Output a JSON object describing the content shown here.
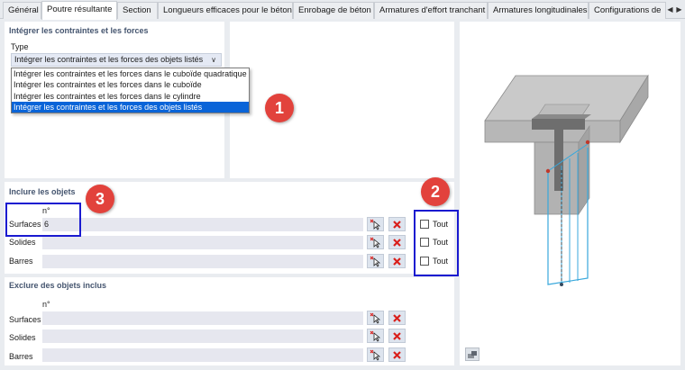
{
  "tabs": [
    {
      "label": "Général",
      "active": false
    },
    {
      "label": "Poutre résultante",
      "active": true
    },
    {
      "label": "Section",
      "active": false
    },
    {
      "label": "Longueurs efficaces pour le béton",
      "active": false
    },
    {
      "label": "Enrobage de béton",
      "active": false
    },
    {
      "label": "Armatures d'effort tranchant",
      "active": false
    },
    {
      "label": "Armatures longitudinales",
      "active": false
    },
    {
      "label": "Configurations de",
      "active": false
    }
  ],
  "integrate": {
    "title": "Intégrer les contraintes et les forces",
    "type_label": "Type",
    "selected": "Intégrer les contraintes et les forces des objets listés",
    "options": [
      "Intégrer les contraintes et les forces dans le cuboïde quadratique",
      "Intégrer les contraintes et les forces dans le cuboïde",
      "Intégrer les contraintes et les forces dans le cylindre",
      "Intégrer les contraintes et les forces des objets listés"
    ]
  },
  "include": {
    "title": "Inclure les objets",
    "col_header": "n°",
    "rows": [
      {
        "label": "Surfaces",
        "value": "6",
        "all_label": "Tout"
      },
      {
        "label": "Solides",
        "value": "",
        "all_label": "Tout"
      },
      {
        "label": "Barres",
        "value": "",
        "all_label": "Tout"
      }
    ]
  },
  "exclude": {
    "title": "Exclure des objets inclus",
    "col_header": "n°",
    "rows": [
      {
        "label": "Surfaces",
        "value": ""
      },
      {
        "label": "Solides",
        "value": ""
      },
      {
        "label": "Barres",
        "value": ""
      }
    ]
  },
  "callouts": [
    "1",
    "2",
    "3"
  ],
  "colors": {
    "accent": "#0a64d8",
    "callout": "#e2423c",
    "highlight": "#1a1ad0",
    "delete": "#d9201c",
    "section_title": "#45556f"
  },
  "icons": {
    "select": "pick-cursor-icon",
    "delete": "delete-x-icon",
    "view": "view-settings-icon",
    "scroll_left": "chevron-left-icon",
    "scroll_right": "chevron-right-icon"
  }
}
